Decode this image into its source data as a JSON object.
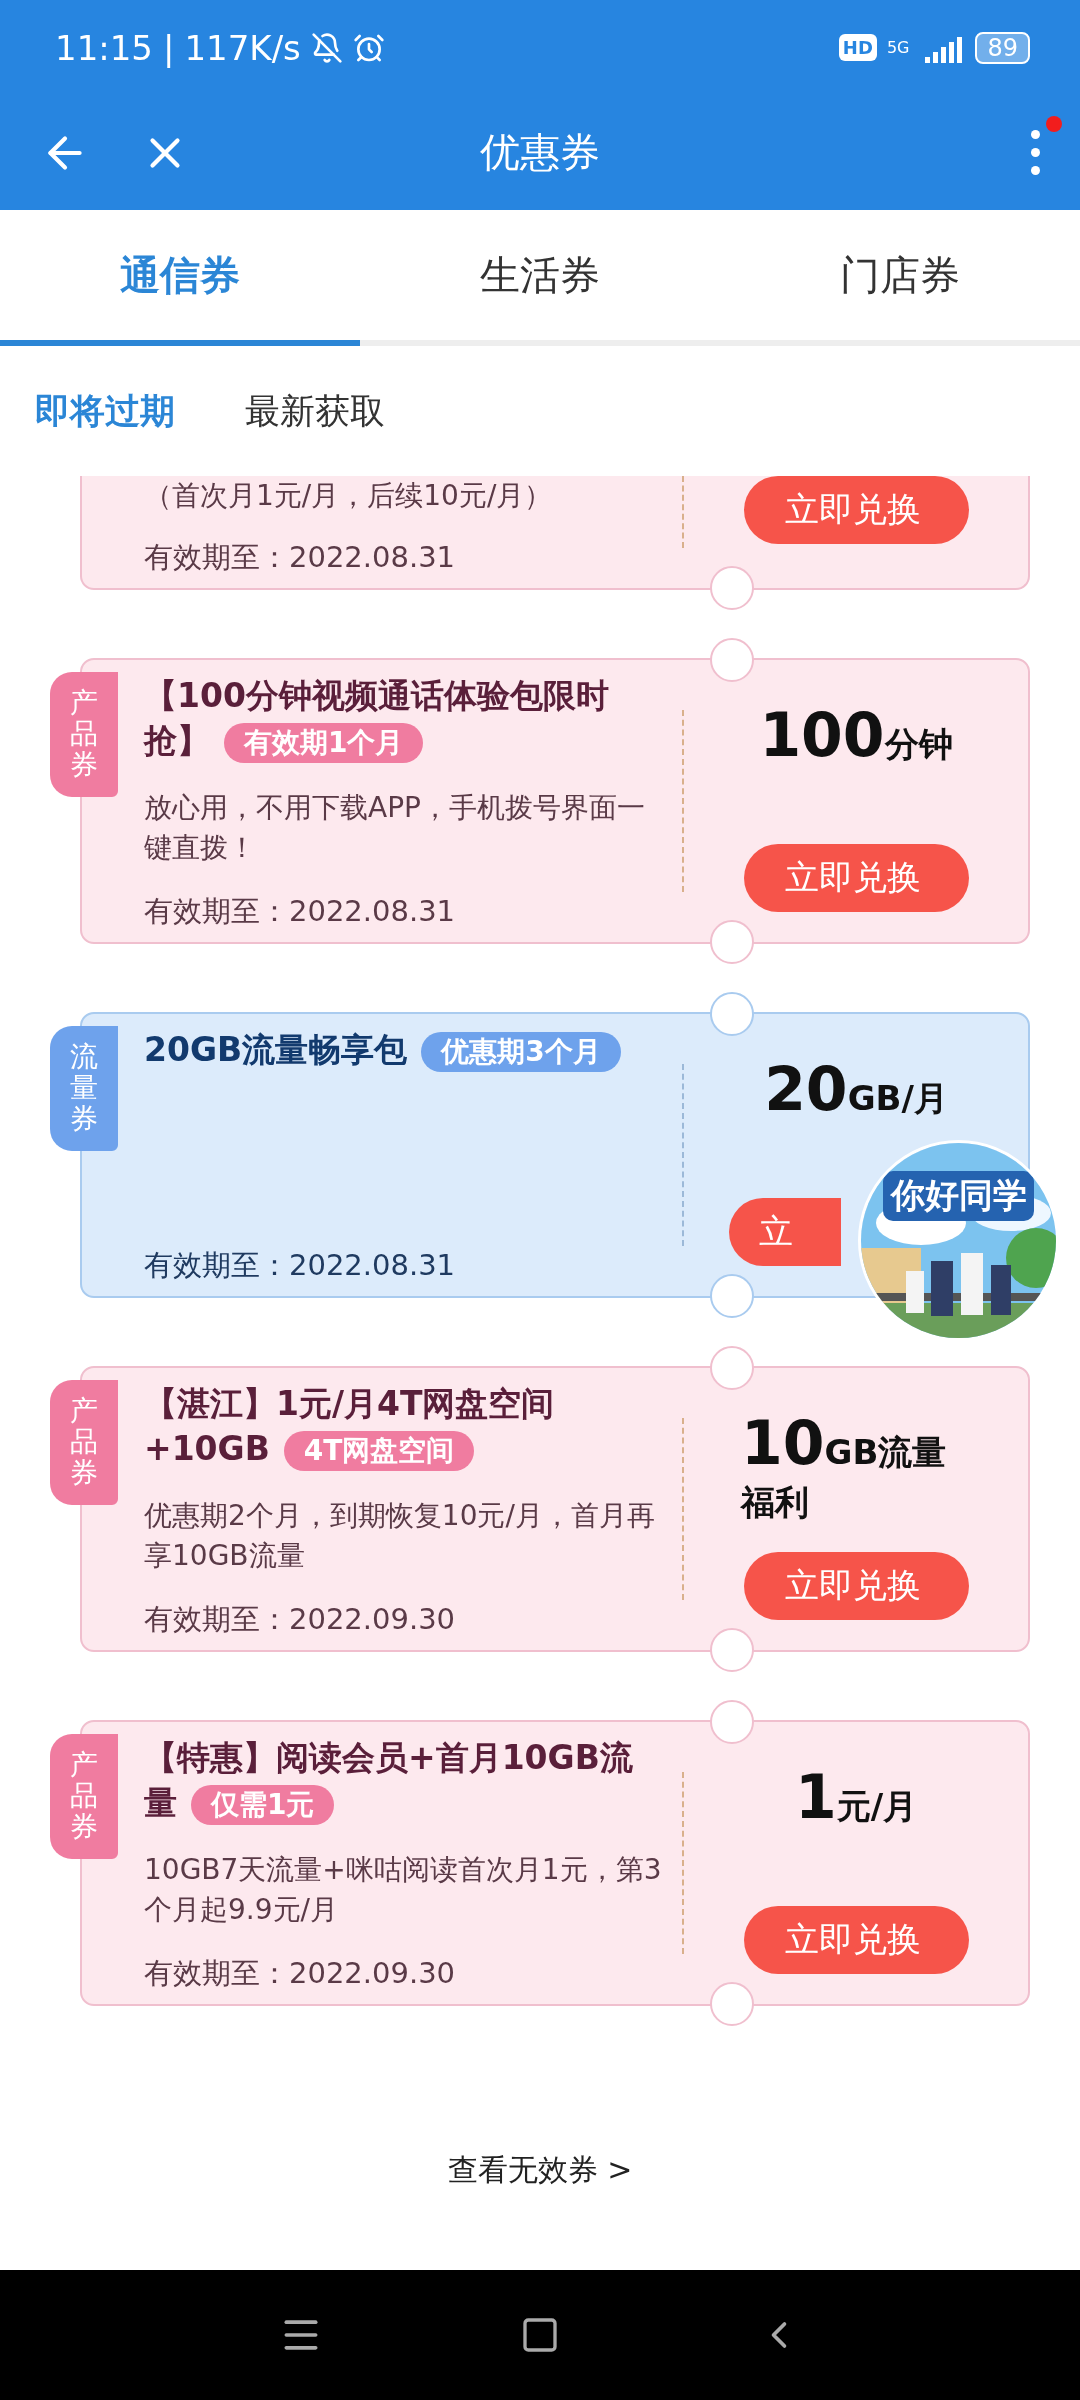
{
  "status_bar": {
    "time": "11:15",
    "separator": "|",
    "speed": "117K/s",
    "hd": "HD",
    "network": "5G",
    "battery": "89"
  },
  "header": {
    "title": "优惠券",
    "has_notification": true
  },
  "tabs": [
    {
      "label": "通信券",
      "selected": true
    },
    {
      "label": "生活券",
      "selected": false
    },
    {
      "label": "门店券",
      "selected": false
    }
  ],
  "filters": [
    {
      "label": "即将过期",
      "selected": true
    },
    {
      "label": "最新获取",
      "selected": false
    }
  ],
  "coupons": [
    {
      "kind": "product",
      "partial": true,
      "description": "（首次月1元/月，后续10元/月）",
      "validity": "有效期至：2022.08.31",
      "button": "立即兑换"
    },
    {
      "kind": "product",
      "partial": false,
      "tag": "产品券",
      "title": "【100分钟视频通话体验包限时抢】",
      "badge": "有效期1个月",
      "description": "放心用，不用下载APP，手机拨号界面一键直拨！",
      "validity": "有效期至：2022.08.31",
      "amount": "100",
      "unit": "分钟",
      "button": "立即兑换"
    },
    {
      "kind": "data",
      "partial": false,
      "tag": "流量券",
      "title": "20GB流量畅享包",
      "badge": "优惠期3个月",
      "validity": "有效期至：2022.08.31",
      "amount": "20",
      "unit": "GB/月",
      "button": "立",
      "button_covered": true
    },
    {
      "kind": "product",
      "partial": false,
      "tag": "产品券",
      "title": "【湛江】1元/月4T网盘空间+10GB",
      "badge": "4T网盘空间",
      "description": "优惠期2个月，到期恢复10元/月，首月再享10GB流量",
      "validity": "有效期至：2022.09.30",
      "amount": "10",
      "unit": "GB流量福利",
      "button": "立即兑换"
    },
    {
      "kind": "product",
      "partial": false,
      "tag": "产品券",
      "title": "【特惠】阅读会员+首月10GB流量",
      "badge": "仅需1元",
      "description": "10GB7天流量+咪咕阅读首次月1元，第3个月起9.9元/月",
      "validity": "有效期至：2022.09.30",
      "amount": "1",
      "unit": "元/月",
      "button": "立即兑换"
    }
  ],
  "greeting_bubble": {
    "text": "你好同学"
  },
  "footer_link": "查看无效券 >"
}
